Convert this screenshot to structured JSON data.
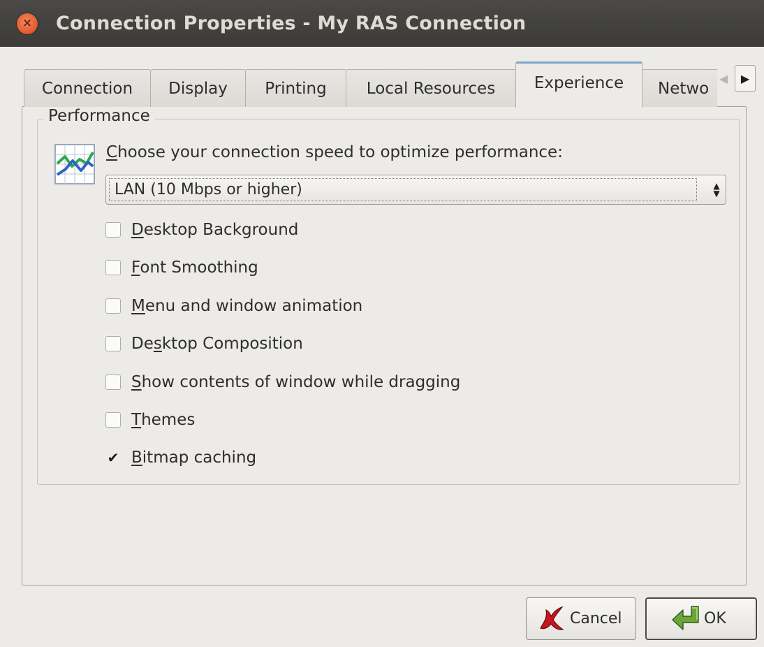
{
  "window": {
    "title": "Connection Properties - My RAS Connection",
    "close_glyph": "×"
  },
  "tabs": [
    {
      "label": "Connection",
      "active": false
    },
    {
      "label": "Display",
      "active": false
    },
    {
      "label": "Printing",
      "active": false
    },
    {
      "label": "Local Resources",
      "active": false
    },
    {
      "label": "Experience",
      "active": true
    },
    {
      "label": "Netwo",
      "active": false
    }
  ],
  "tab_scroll": {
    "left_glyph": "◀",
    "right_glyph": "▶"
  },
  "performance": {
    "legend": "Performance",
    "icon": "performance-chart-icon",
    "speed_label_first": "C",
    "speed_label_rest": "hoose your connection speed to optimize performance:",
    "speed_value": "LAN (10 Mbps or higher)",
    "checkboxes": [
      {
        "mnemonic": "D",
        "rest": "esktop Background",
        "checked": false
      },
      {
        "mnemonic": "F",
        "rest": "ont Smoothing",
        "checked": false
      },
      {
        "mnemonic": "M",
        "rest": "enu and window animation",
        "checked": false
      },
      {
        "pre": "De",
        "mnemonic": "s",
        "rest": "ktop Composition",
        "checked": false
      },
      {
        "mnemonic": "S",
        "rest": "how contents of window while dragging",
        "checked": false
      },
      {
        "mnemonic": "T",
        "rest": "hemes",
        "checked": false
      },
      {
        "mnemonic": "B",
        "rest": "itmap caching",
        "checked": true
      }
    ]
  },
  "buttons": {
    "cancel": {
      "label": "Cancel",
      "icon": "red-x-icon"
    },
    "ok": {
      "label": "OK",
      "icon": "green-arrow-icon"
    }
  },
  "colors": {
    "titlebar": "#3c3b38",
    "close_button": "#e0582b",
    "active_tab_accent": "#7fa6c9",
    "background": "#edebe8"
  }
}
